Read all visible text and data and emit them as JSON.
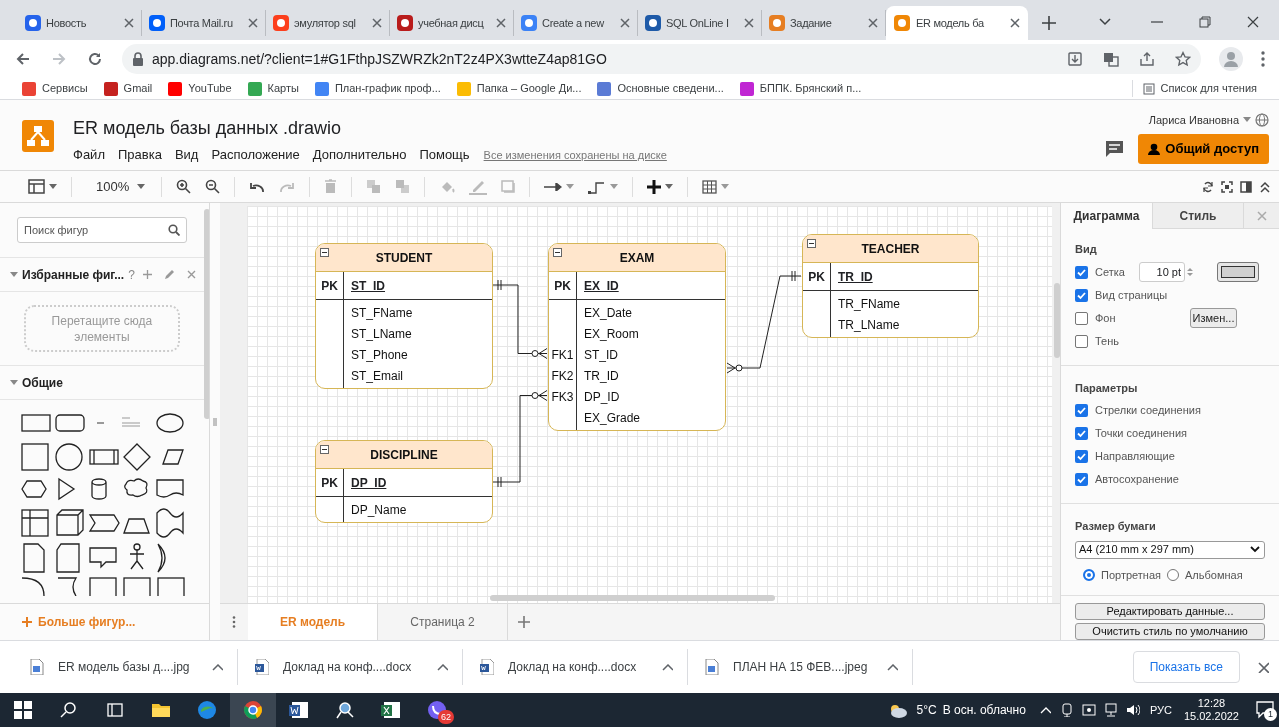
{
  "browser": {
    "tabs": [
      {
        "title": "Новость",
        "selected": false,
        "color": "#2563eb"
      },
      {
        "title": "Почта Mail.ru",
        "selected": false,
        "color": "#005ff9"
      },
      {
        "title": "эмулятор sql",
        "selected": false,
        "color": "#fc3f1d"
      },
      {
        "title": "учебная дисц",
        "selected": false,
        "color": "#b91c1c"
      },
      {
        "title": "Create a new",
        "selected": false,
        "color": "#3b82f6"
      },
      {
        "title": "SQL OnLine I",
        "selected": false,
        "color": "#1e5aa8"
      },
      {
        "title": "Задание",
        "selected": false,
        "color": "#e67e22"
      },
      {
        "title": "ER модель ба",
        "selected": true,
        "color": "#f08705"
      }
    ],
    "address": "app.diagrams.net/?client=1#G1FthpJSZWRZk2nT2z4PX3wtteZ4ap81GO",
    "bookmarks": [
      {
        "label": "Сервисы",
        "color": "#ea4335"
      },
      {
        "label": "Gmail",
        "color": "#c5221f"
      },
      {
        "label": "YouTube",
        "color": "#ff0000"
      },
      {
        "label": "Карты",
        "color": "#34a853"
      },
      {
        "label": "План-график проф...",
        "color": "#4285f4"
      },
      {
        "label": "Папка – Google Ди...",
        "color": "#fbbc04"
      },
      {
        "label": "Основные сведени...",
        "color": "#5b7bd5"
      },
      {
        "label": "БППК. Брянский п...",
        "color": "#c026d3"
      }
    ],
    "reading_list": "Список для чтения"
  },
  "app": {
    "title": "ER модель базы данных .drawio",
    "menu": [
      "Файл",
      "Правка",
      "Вид",
      "Расположение",
      "Дополнительно",
      "Помощь"
    ],
    "save_status": "Все изменения сохранены на диске",
    "user": "Лариса Ивановна",
    "share": "Общий доступ"
  },
  "toolbar": {
    "zoom": "100%"
  },
  "sidebar": {
    "search_placeholder": "Поиск фигур",
    "favorites": {
      "title": "Избранные фиг...",
      "help": "?",
      "expanded": true,
      "drop_hint": "Перетащите сюда элементы"
    },
    "general": {
      "title": "Общие",
      "expanded": true
    },
    "more_shapes": "Больше фигур..."
  },
  "diagram": {
    "entities": [
      {
        "name": "STUDENT",
        "pk": {
          "key": "PK",
          "field": "ST_ID"
        },
        "attributes": [
          {
            "field": "ST_FName"
          },
          {
            "field": "ST_LName"
          },
          {
            "field": "ST_Phone"
          },
          {
            "field": "ST_Email"
          }
        ]
      },
      {
        "name": "EXAM",
        "pk": {
          "key": "PK",
          "field": "EX_ID"
        },
        "attributes": [
          {
            "field": "EX_Date"
          },
          {
            "field": "EX_Room"
          },
          {
            "key": "FK1",
            "field": "ST_ID"
          },
          {
            "key": "FK2",
            "field": "TR_ID"
          },
          {
            "key": "FK3",
            "field": "DP_ID"
          },
          {
            "field": "EX_Grade"
          }
        ]
      },
      {
        "name": "TEACHER",
        "pk": {
          "key": "PK",
          "field": "TR_ID"
        },
        "attributes": [
          {
            "field": "TR_FName"
          },
          {
            "field": "TR_LName"
          }
        ]
      },
      {
        "name": "DISCIPLINE",
        "pk": {
          "key": "PK",
          "field": "DP_ID"
        },
        "attributes": [
          {
            "field": "DP_Name"
          }
        ]
      }
    ]
  },
  "pages": [
    {
      "label": "ER модель",
      "selected": true
    },
    {
      "label": "Страница 2",
      "selected": false
    }
  ],
  "format_panel": {
    "tabs": [
      {
        "label": "Диаграмма",
        "selected": true
      },
      {
        "label": "Стиль",
        "selected": false
      }
    ],
    "view_title": "Вид",
    "view_options": [
      {
        "kind": "grid",
        "label": "Сетка",
        "checked": true,
        "value": "10 pt"
      },
      {
        "kind": "plain",
        "label": "Вид страницы",
        "checked": true
      },
      {
        "kind": "background",
        "label": "Фон",
        "checked": false,
        "button": "Измен..."
      },
      {
        "kind": "plain",
        "label": "Тень",
        "checked": false
      }
    ],
    "options_title": "Параметры",
    "options": [
      {
        "label": "Стрелки соединения",
        "checked": true
      },
      {
        "label": "Точки соединения",
        "checked": true
      },
      {
        "label": "Направляющие",
        "checked": true
      },
      {
        "label": "Автосохранение",
        "checked": true
      }
    ],
    "paper_title": "Размер бумаги",
    "paper_size": "A4 (210 mm x 297 mm)",
    "orientation": [
      {
        "label": "Портретная",
        "selected": true
      },
      {
        "label": "Альбомная",
        "selected": false
      }
    ],
    "buttons": [
      "Редактировать данные...",
      "Очистить стиль по умолчанию"
    ]
  },
  "downloads": {
    "items": [
      {
        "name": "ER модель базы д....jpg",
        "kind": "image"
      },
      {
        "name": "Доклад на конф....docx",
        "kind": "word"
      },
      {
        "name": "Доклад на конф....docx",
        "kind": "word"
      },
      {
        "name": "ПЛАН НА 15 ФЕВ....jpeg",
        "kind": "image"
      }
    ],
    "show_all": "Показать все"
  },
  "taskbar": {
    "badge": "62",
    "temperature": "5°C",
    "weather": "В осн. облачно",
    "language": "РУС",
    "time": "12:28",
    "date": "15.02.2022",
    "notifications": "1"
  }
}
